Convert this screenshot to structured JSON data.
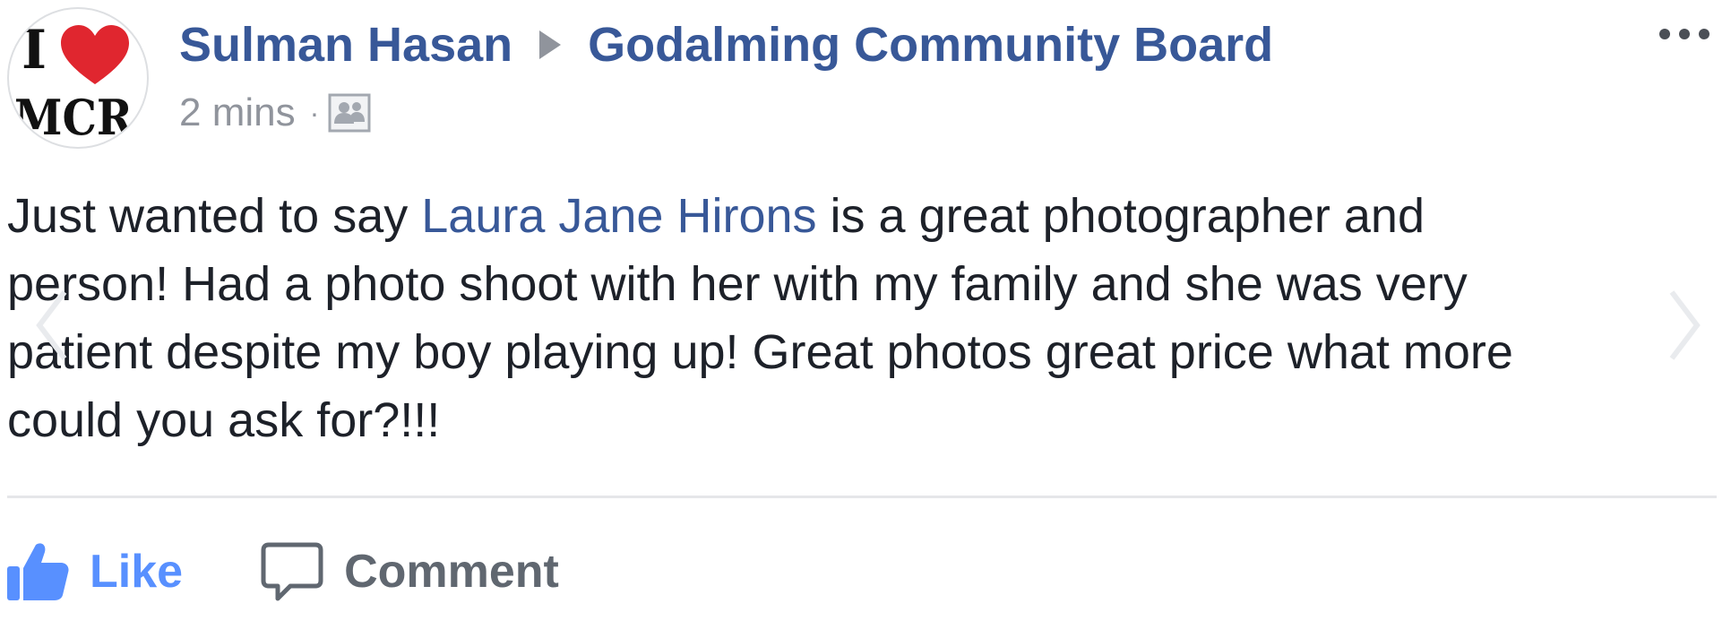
{
  "post": {
    "author": "Sulman Hasan",
    "group": "Godalming Community Board",
    "timestamp": "2 mins",
    "separator": "·",
    "audience_icon": "group-audience-icon",
    "avatar": {
      "icon": "i-love-mcr-avatar",
      "top_letter": "I",
      "bottom_text": "MCR"
    },
    "text": {
      "line1_before": "Just wanted to say ",
      "mention": "Laura Jane Hirons",
      "line1_after": " is a great photographer and",
      "line2": "person! Had a photo shoot with her with my family and she was very",
      "line3": "patient despite my boy playing up! Great photos great price what more",
      "line4": "could you ask for?!!!"
    }
  },
  "actions": {
    "like_label": "Like",
    "comment_label": "Comment"
  },
  "colors": {
    "link": "#385898",
    "like": "#5890ff",
    "muted": "#90949c",
    "text": "#1d2129",
    "heart": "#e0262f"
  }
}
